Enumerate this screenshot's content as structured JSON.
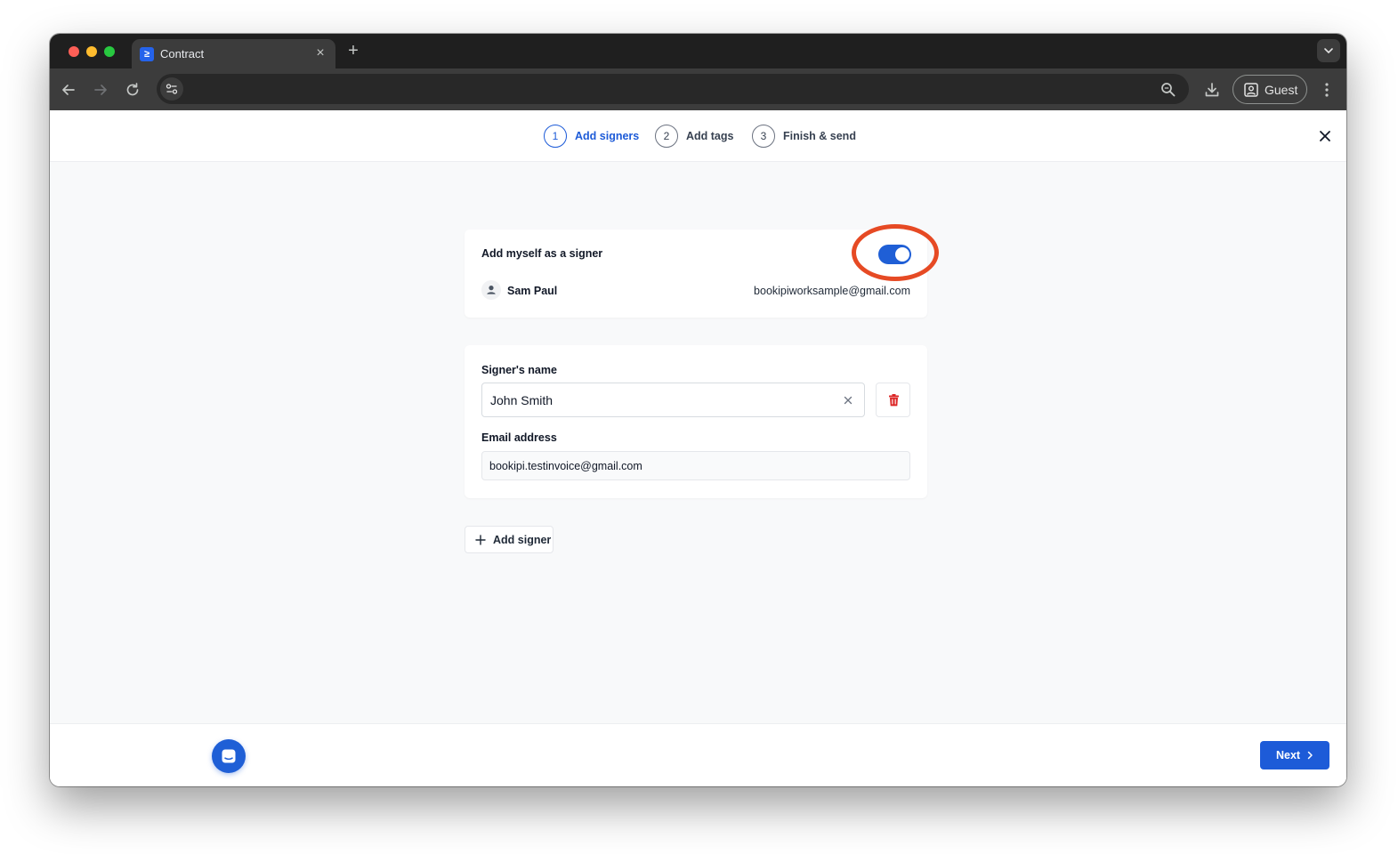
{
  "browser": {
    "tab_title": "Contract",
    "favicon_glyph": "≥",
    "close_tab_glyph": "×",
    "new_tab_glyph": "+",
    "profile_label": "Guest"
  },
  "wizard": {
    "steps": [
      {
        "number": "1",
        "label": "Add signers",
        "active": true
      },
      {
        "number": "2",
        "label": "Add tags",
        "active": false
      },
      {
        "number": "3",
        "label": "Finish & send",
        "active": false
      }
    ]
  },
  "self_signer": {
    "title": "Add myself as a signer",
    "toggle_on": true,
    "name": "Sam Paul",
    "email": "bookipiworksample@gmail.com"
  },
  "signer": {
    "name_label": "Signer's name",
    "name_value": "John Smith",
    "email_label": "Email address",
    "email_value": "bookipi.testinvoice@gmail.com"
  },
  "actions": {
    "add_signer_label": "Add signer",
    "next_label": "Next"
  },
  "colors": {
    "accent": "#1d5bd8",
    "highlight_ring": "#e64a24",
    "delete": "#dc2626"
  }
}
